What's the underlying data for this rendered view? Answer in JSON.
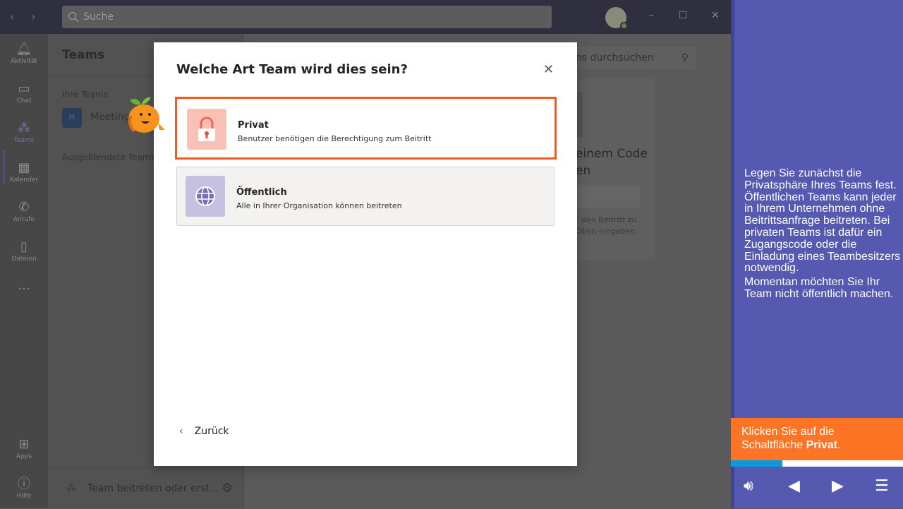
{
  "topbar": {
    "search_placeholder": "Suche",
    "back_icon": "chevron-left",
    "forward_icon": "chevron-right",
    "minimize": "–",
    "maximize": "☐",
    "close": "✕"
  },
  "rail": {
    "items": [
      {
        "label": "Aktivität",
        "icon": "bell"
      },
      {
        "label": "Chat",
        "icon": "chat"
      },
      {
        "label": "Teams",
        "icon": "teams",
        "active": true
      },
      {
        "label": "Kalender",
        "icon": "calendar"
      },
      {
        "label": "Anrufe",
        "icon": "phone"
      },
      {
        "label": "Dateien",
        "icon": "file"
      },
      {
        "label": "Apps",
        "icon": "apps"
      },
      {
        "label": "Hilfe",
        "icon": "help"
      }
    ],
    "more": "···"
  },
  "panel": {
    "title": "Teams",
    "your_teams": "Ihre Teams",
    "team_initial": "M",
    "team_name": "Meetings",
    "hidden_teams": "Ausgeblendete Teams",
    "join_label": "Team beitreten oder erst..."
  },
  "main": {
    "search_placeholder": "Teams durchsuchen",
    "search_visible": "ns durchsuchen",
    "card_title_1": "einem Code",
    "card_title_2": "en",
    "card_desc_1": "r den Beitritt zu",
    "card_desc_2": "Oben eingeben."
  },
  "modal": {
    "title": "Welche Art Team wird dies sein?",
    "close_icon": "close",
    "options": [
      {
        "title": "Privat",
        "desc": "Benutzer benötigen die Berechtigung zum Beitritt",
        "icon": "lock",
        "color": "#f9c0b5"
      },
      {
        "title": "Öffentlich",
        "desc": "Alle in Ihrer Organisation können beitreten",
        "icon": "globe",
        "color": "#c5c1e0"
      }
    ],
    "back_label": "Zurück"
  },
  "tutorial": {
    "text_1": "Legen Sie zunächst die Privatsphäre Ihres Teams fest. Öffentlichen Teams kann jeder in Ihrem Unternehmen ohne Beitrittsanfrage beitreten. Bei privaten Teams ist dafür ein Zugangscode oder die Einladung eines Teambesitzers notwendig.",
    "text_2": "Momentan möchten Sie Ihr Team nicht öffentlich machen.",
    "instruction_pre": "Klicken Sie auf die Schaltfläche ",
    "instruction_bold": "Privat",
    "instruction_post": ".",
    "progress_percent": 30,
    "colors": {
      "panel": "#5659b0",
      "instruction": "#fd7424",
      "progress": "#0a9ae0",
      "highlight": "#f05a23"
    }
  }
}
